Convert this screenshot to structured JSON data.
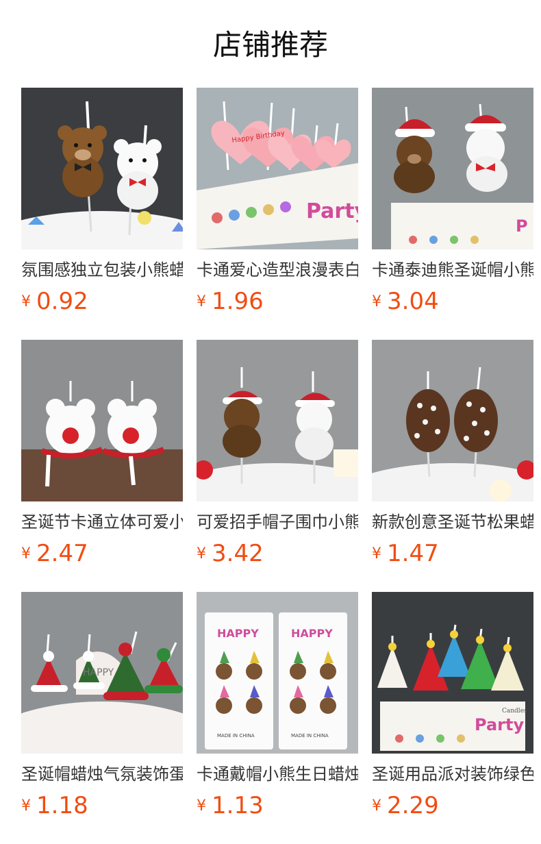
{
  "header": {
    "title": "店铺推荐"
  },
  "currency_symbol": "¥",
  "products": [
    {
      "name": "氛围感独立包装小熊蜡烛",
      "price": "0.92",
      "image": "two-bears-candles"
    },
    {
      "name": "卡通爱心造型浪漫表白蜡烛",
      "price": "1.96",
      "image": "heart-happy-birthday-candles"
    },
    {
      "name": "卡通泰迪熊圣诞帽小熊蜡烛",
      "price": "3.04",
      "image": "santa-hat-bears-candles"
    },
    {
      "name": "圣诞节卡通立体可爱小鹿蜡烛",
      "price": "2.47",
      "image": "reindeer-scarf-candles"
    },
    {
      "name": "可爱招手帽子围巾小熊蜡烛",
      "price": "3.42",
      "image": "waving-bears-scarf-candles"
    },
    {
      "name": "新款创意圣诞节松果蜡烛",
      "price": "1.47",
      "image": "pine-cone-candles"
    },
    {
      "name": "圣诞帽蜡烛气氛装饰蛋糕",
      "price": "1.18",
      "image": "christmas-hat-candles"
    },
    {
      "name": "卡通戴帽小熊生日蜡烛",
      "price": "1.13",
      "image": "party-hat-bears-pack"
    },
    {
      "name": "圣诞用品派对装饰绿色蜡烛",
      "price": "2.29",
      "image": "christmas-tree-candles"
    }
  ],
  "package_text": {
    "happy": "HAPPY",
    "birthday": "Happy Birthday",
    "party": "Party",
    "candles": "Candles",
    "made_in": "MADE IN CHINA"
  }
}
